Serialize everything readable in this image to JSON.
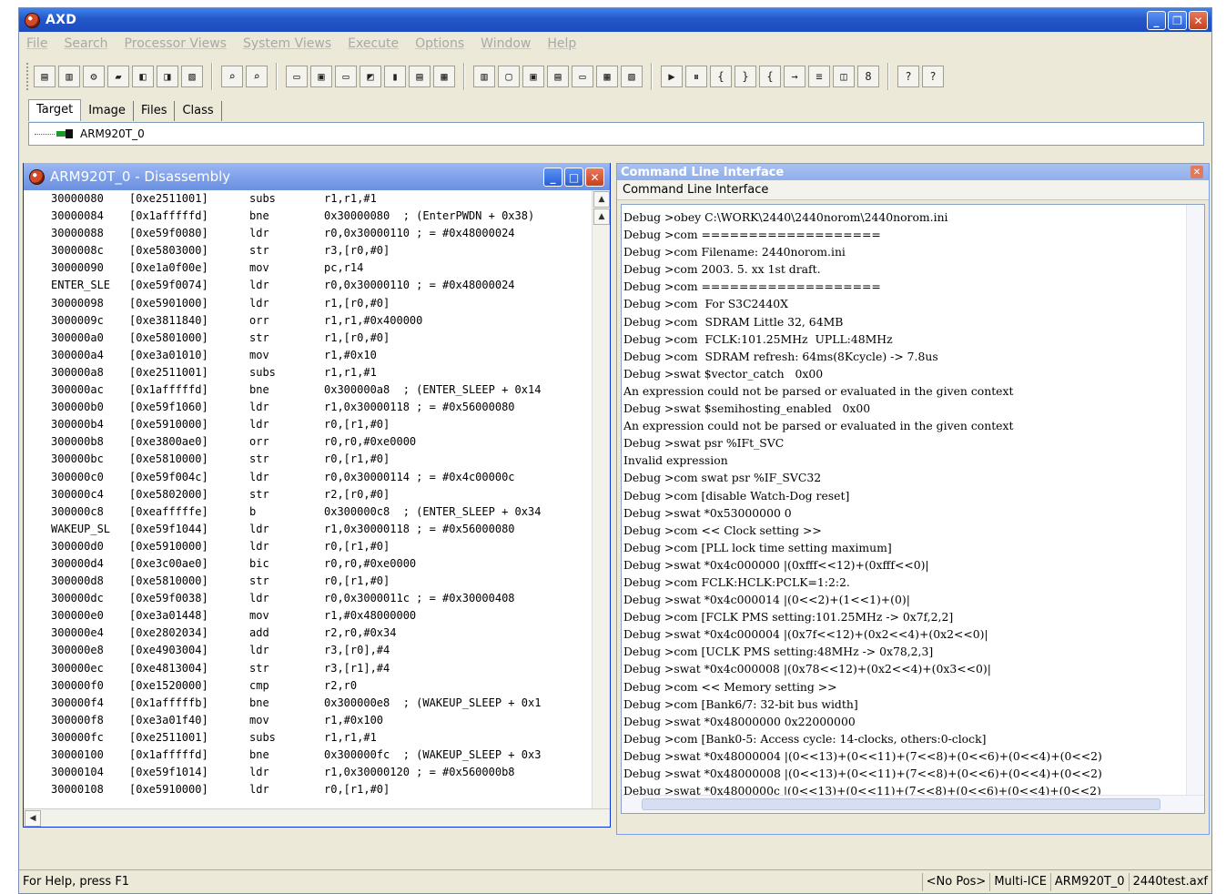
{
  "window": {
    "title": "AXD"
  },
  "menu": [
    "File",
    "Search",
    "Processor Views",
    "System Views",
    "Execute",
    "Options",
    "Window",
    "Help"
  ],
  "tabs": [
    "Target",
    "Image",
    "Files",
    "Class"
  ],
  "target_item": "ARM920T_0",
  "disassembly": {
    "title": "ARM920T_0 - Disassembly",
    "rows": [
      {
        "addr": "30000080",
        "op": "[0xe2511001]",
        "mn": "subs",
        "arg": "r1,r1,#1"
      },
      {
        "addr": "30000084",
        "op": "[0x1afffffd]",
        "mn": "bne",
        "arg": "0x30000080  ; (EnterPWDN + 0x38)"
      },
      {
        "addr": "30000088",
        "op": "[0xe59f0080]",
        "mn": "ldr",
        "arg": "r0,0x30000110 ; = #0x48000024"
      },
      {
        "addr": "3000008c",
        "op": "[0xe5803000]",
        "mn": "str",
        "arg": "r3,[r0,#0]"
      },
      {
        "addr": "30000090",
        "op": "[0xe1a0f00e]",
        "mn": "mov",
        "arg": "pc,r14"
      },
      {
        "addr": "ENTER_SLE",
        "op": "[0xe59f0074]",
        "mn": "ldr",
        "arg": "r0,0x30000110 ; = #0x48000024"
      },
      {
        "addr": "30000098",
        "op": "[0xe5901000]",
        "mn": "ldr",
        "arg": "r1,[r0,#0]"
      },
      {
        "addr": "3000009c",
        "op": "[0xe3811840]",
        "mn": "orr",
        "arg": "r1,r1,#0x400000"
      },
      {
        "addr": "300000a0",
        "op": "[0xe5801000]",
        "mn": "str",
        "arg": "r1,[r0,#0]"
      },
      {
        "addr": "300000a4",
        "op": "[0xe3a01010]",
        "mn": "mov",
        "arg": "r1,#0x10"
      },
      {
        "addr": "300000a8",
        "op": "[0xe2511001]",
        "mn": "subs",
        "arg": "r1,r1,#1"
      },
      {
        "addr": "300000ac",
        "op": "[0x1afffffd]",
        "mn": "bne",
        "arg": "0x300000a8  ; (ENTER_SLEEP + 0x14"
      },
      {
        "addr": "300000b0",
        "op": "[0xe59f1060]",
        "mn": "ldr",
        "arg": "r1,0x30000118 ; = #0x56000080"
      },
      {
        "addr": "300000b4",
        "op": "[0xe5910000]",
        "mn": "ldr",
        "arg": "r0,[r1,#0]"
      },
      {
        "addr": "300000b8",
        "op": "[0xe3800ae0]",
        "mn": "orr",
        "arg": "r0,r0,#0xe0000"
      },
      {
        "addr": "300000bc",
        "op": "[0xe5810000]",
        "mn": "str",
        "arg": "r0,[r1,#0]"
      },
      {
        "addr": "300000c0",
        "op": "[0xe59f004c]",
        "mn": "ldr",
        "arg": "r0,0x30000114 ; = #0x4c00000c"
      },
      {
        "addr": "300000c4",
        "op": "[0xe5802000]",
        "mn": "str",
        "arg": "r2,[r0,#0]"
      },
      {
        "addr": "300000c8",
        "op": "[0xeafffffe]",
        "mn": "b",
        "arg": "0x300000c8  ; (ENTER_SLEEP + 0x34"
      },
      {
        "addr": "WAKEUP_SL",
        "op": "[0xe59f1044]",
        "mn": "ldr",
        "arg": "r1,0x30000118 ; = #0x56000080"
      },
      {
        "addr": "300000d0",
        "op": "[0xe5910000]",
        "mn": "ldr",
        "arg": "r0,[r1,#0]"
      },
      {
        "addr": "300000d4",
        "op": "[0xe3c00ae0]",
        "mn": "bic",
        "arg": "r0,r0,#0xe0000"
      },
      {
        "addr": "300000d8",
        "op": "[0xe5810000]",
        "mn": "str",
        "arg": "r0,[r1,#0]"
      },
      {
        "addr": "300000dc",
        "op": "[0xe59f0038]",
        "mn": "ldr",
        "arg": "r0,0x3000011c ; = #0x30000408"
      },
      {
        "addr": "300000e0",
        "op": "[0xe3a01448]",
        "mn": "mov",
        "arg": "r1,#0x48000000"
      },
      {
        "addr": "300000e4",
        "op": "[0xe2802034]",
        "mn": "add",
        "arg": "r2,r0,#0x34"
      },
      {
        "addr": "300000e8",
        "op": "[0xe4903004]",
        "mn": "ldr",
        "arg": "r3,[r0],#4"
      },
      {
        "addr": "300000ec",
        "op": "[0xe4813004]",
        "mn": "str",
        "arg": "r3,[r1],#4"
      },
      {
        "addr": "300000f0",
        "op": "[0xe1520000]",
        "mn": "cmp",
        "arg": "r2,r0"
      },
      {
        "addr": "300000f4",
        "op": "[0x1afffffb]",
        "mn": "bne",
        "arg": "0x300000e8  ; (WAKEUP_SLEEP + 0x1"
      },
      {
        "addr": "300000f8",
        "op": "[0xe3a01f40]",
        "mn": "mov",
        "arg": "r1,#0x100"
      },
      {
        "addr": "300000fc",
        "op": "[0xe2511001]",
        "mn": "subs",
        "arg": "r1,r1,#1"
      },
      {
        "addr": "30000100",
        "op": "[0x1afffffd]",
        "mn": "bne",
        "arg": "0x300000fc  ; (WAKEUP_SLEEP + 0x3"
      },
      {
        "addr": "30000104",
        "op": "[0xe59f1014]",
        "mn": "ldr",
        "arg": "r1,0x30000120 ; = #0x560000b8"
      },
      {
        "addr": "30000108",
        "op": "[0xe5910000]",
        "mn": "ldr",
        "arg": "r0,[r1,#0]"
      }
    ]
  },
  "cli": {
    "title": "Command Line Interface",
    "subtitle": "Command Line Interface",
    "lines": [
      "Debug >obey C:\\WORK\\2440\\2440norom\\2440norom.ini",
      "Debug >com ===================",
      "Debug >com Filename: 2440norom.ini",
      "Debug >com 2003. 5. xx 1st draft.",
      "Debug >com ===================",
      "Debug >com  For S3C2440X",
      "Debug >com  SDRAM Little 32, 64MB",
      "Debug >com  FCLK:101.25MHz  UPLL:48MHz",
      "Debug >com  SDRAM refresh: 64ms(8Kcycle) -> 7.8us",
      "Debug >swat $vector_catch   0x00",
      "An expression could not be parsed or evaluated in the given context",
      "Debug >swat $semihosting_enabled   0x00",
      "An expression could not be parsed or evaluated in the given context",
      "Debug >swat psr %IFt_SVC",
      "Invalid expression",
      "Debug >com swat psr %IF_SVC32",
      "Debug >com [disable Watch-Dog reset]",
      "Debug >swat *0x53000000 0",
      "Debug >com << Clock setting >>",
      "Debug >com [PLL lock time setting maximum]",
      "Debug >swat *0x4c000000 |(0xfff<<12)+(0xfff<<0)|",
      "Debug >com FCLK:HCLK:PCLK=1:2:2.",
      "Debug >swat *0x4c000014 |(0<<2)+(1<<1)+(0)|",
      "Debug >com [FCLK PMS setting:101.25MHz -> 0x7f,2,2]",
      "Debug >swat *0x4c000004 |(0x7f<<12)+(0x2<<4)+(0x2<<0)|",
      "Debug >com [UCLK PMS setting:48MHz -> 0x78,2,3]",
      "Debug >swat *0x4c000008 |(0x78<<12)+(0x2<<4)+(0x3<<0)|",
      "Debug >com << Memory setting >>",
      "Debug >com [Bank6/7: 32-bit bus width]",
      "Debug >swat *0x48000000 0x22000000",
      "Debug >com [Bank0-5: Access cycle: 14-clocks, others:0-clock]",
      "Debug >swat *0x48000004 |(0<<13)+(0<<11)+(7<<8)+(0<<6)+(0<<4)+(0<<2)",
      "Debug >swat *0x48000008 |(0<<13)+(0<<11)+(7<<8)+(0<<6)+(0<<4)+(0<<2)",
      "Debug >swat *0x4800000c |(0<<13)+(0<<11)+(7<<8)+(0<<6)+(0<<4)+(0<<2)"
    ]
  },
  "status": {
    "help": "For Help, press F1",
    "pos": "<No Pos>",
    "target": "Multi-ICE",
    "processor": "ARM920T_0",
    "file": "2440test.axf"
  }
}
